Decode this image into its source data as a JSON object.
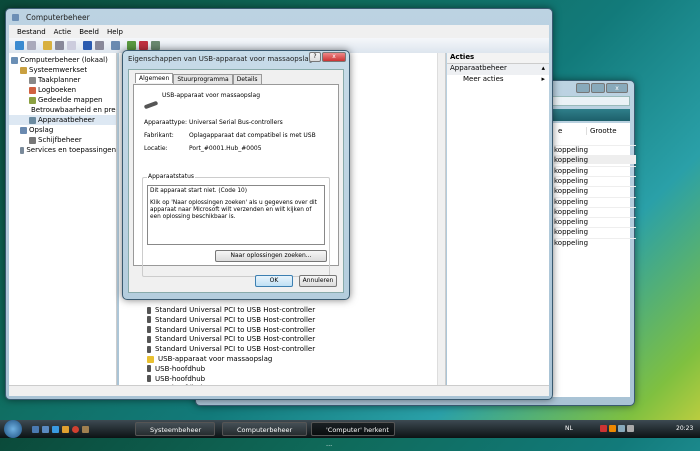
{
  "back_window": {
    "column_headers": [
      "e",
      "Grootte"
    ],
    "rows": [
      "koppeling",
      "koppeling",
      "koppeling",
      "koppeling",
      "koppeling",
      "koppeling",
      "koppeling",
      "koppeling",
      "koppeling",
      "koppeling"
    ]
  },
  "main_window": {
    "title": "Computerbeheer",
    "menu": [
      "Bestand",
      "Actie",
      "Beeld",
      "Help"
    ],
    "tree": [
      {
        "label": "Computerbeheer (lokaal)",
        "level": 0
      },
      {
        "label": "Systeemwerkset",
        "level": 1
      },
      {
        "label": "Taakplanner",
        "level": 2
      },
      {
        "label": "Logboeken",
        "level": 2
      },
      {
        "label": "Gedeelde mappen",
        "level": 2
      },
      {
        "label": "Betrouwbaarheid en prestaties",
        "level": 2
      },
      {
        "label": "Apparaatbeheer",
        "level": 2
      },
      {
        "label": "Opslag",
        "level": 1
      },
      {
        "label": "Schijfbeheer",
        "level": 2
      },
      {
        "label": "Services en toepassingen",
        "level": 1
      }
    ],
    "devices": [
      "Standard Universal PCI to USB Host-controller",
      "Standard Universal PCI to USB Host-controller",
      "Standard Universal PCI to USB Host-controller",
      "Standard Universal PCI to USB Host-controller",
      "Standard Universal PCI to USB Host-controller",
      "USB-apparaat voor massaopslag",
      "USB-hoofdhub",
      "USB-hoofdhub",
      "USB-hoofdhub"
    ],
    "actions": {
      "header": "Acties",
      "section": "Apparaatbeheer",
      "item": "Meer acties"
    }
  },
  "dialog": {
    "title": "Eigenschappen van USB-apparaat voor massaopslag",
    "tabs": [
      "Algemeen",
      "Stuurprogramma",
      "Details"
    ],
    "device_name": "USB-apparaat voor massaopslag",
    "fields": [
      {
        "label": "Apparaattype:",
        "value": "Universal Serial Bus-controllers"
      },
      {
        "label": "Fabrikant:",
        "value": "Oplagapparaat dat compatibel is met USB"
      },
      {
        "label": "Locatie:",
        "value": "Port_#0001.Hub_#0005"
      }
    ],
    "status_label": "Apparaatstatus",
    "status_line1": "Dit apparaat start niet. (Code 10)",
    "status_line2": "Klik op 'Naar oplossingen zoeken' als u gegevens over dit apparaat naar Microsoft wilt verzenden en wilt kijken of een oplossing beschikbaar is.",
    "solutions_button": "Naar oplossingen zoeken...",
    "ok": "OK",
    "cancel": "Annuleren"
  },
  "taskbar": {
    "items": [
      "Systeembeheer",
      "Computerbeheer",
      "'Computer' herkent ..."
    ],
    "lang": "NL",
    "time": "20:23"
  }
}
